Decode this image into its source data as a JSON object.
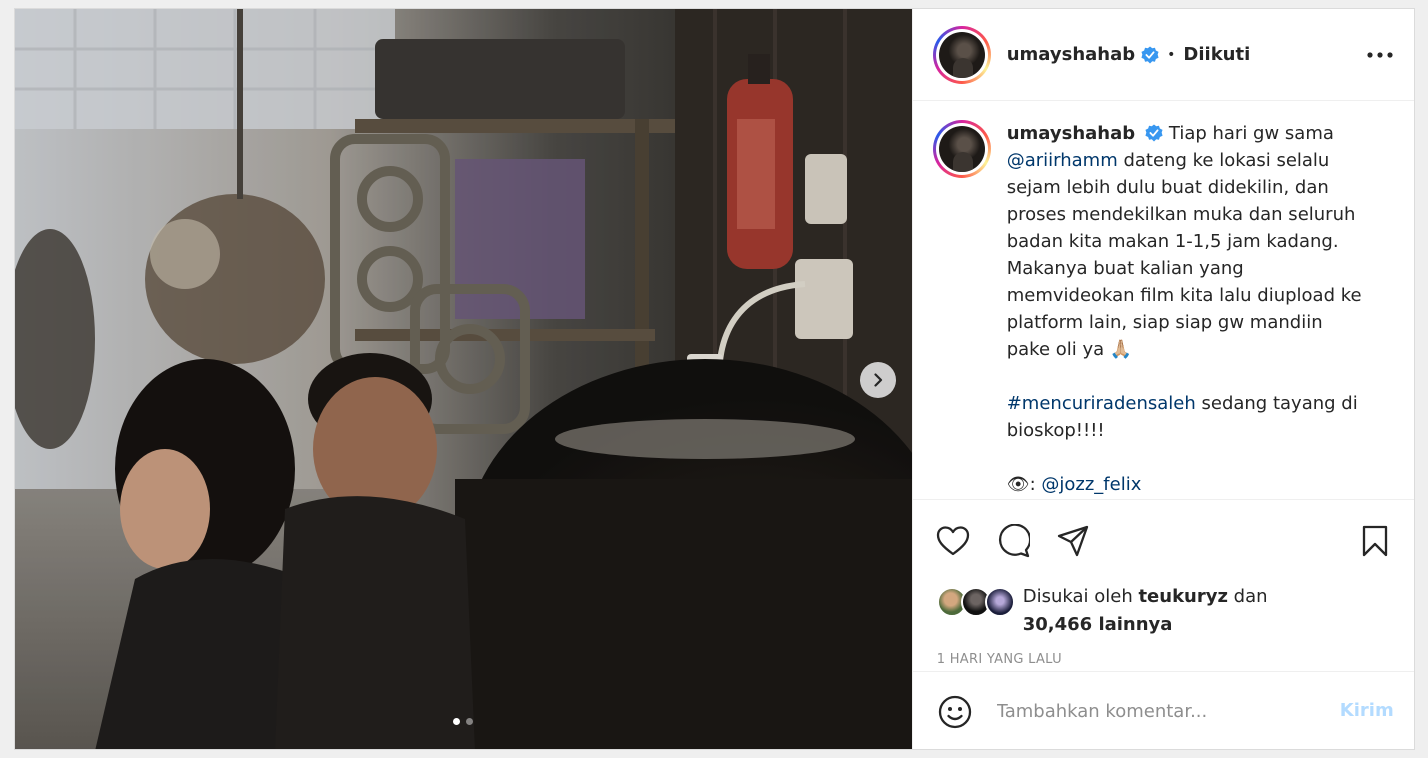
{
  "post": {
    "author": {
      "username": "umayshahab",
      "follow_status": "Diikuti",
      "separator": "•"
    },
    "caption": {
      "paragraphs": [
        {
          "username": "umayshahab",
          "before_mention": "Tiap hari gw sama ",
          "mention": "@ariirhamm",
          "after_mention": " dateng ke lokasi selalu sejam lebih dulu buat didekilin, dan proses mendekilkan muka dan seluruh badan kita makan 1-1,5 jam kadang. Makanya buat kalian yang memvideokan film kita lalu diupload ke platform lain, siap siap gw mandiin pake oli ya 🙏🏼"
        }
      ],
      "hashtag": "#mencuriradensaleh",
      "hashtag_suffix": " sedang tayang di bioskop!!!!",
      "credit_icon": "👁:",
      "credit_mention": "@jozz_felix"
    },
    "likes": {
      "prefix": "Disukai oleh ",
      "top_liker": "teukuryz",
      "middle": " dan",
      "count": "30,466 lainnya"
    },
    "timestamp": "1 HARI YANG LALU",
    "comment": {
      "placeholder": "Tambahkan komentar...",
      "post_label": "Kirim"
    },
    "carousel": {
      "total_slides": 2,
      "active_slide": 1
    }
  },
  "icons": {
    "verified": "verified-badge-icon",
    "more": "more-options-icon",
    "like": "heart-icon",
    "comment": "comment-icon",
    "share": "share-icon",
    "save": "bookmark-icon",
    "emoji": "emoji-icon",
    "next": "chevron-right-icon"
  },
  "colors": {
    "verified": "#3897f0",
    "link": "#00376b",
    "post_button_disabled": "#b3dbff",
    "muted": "#8e8e8e"
  }
}
